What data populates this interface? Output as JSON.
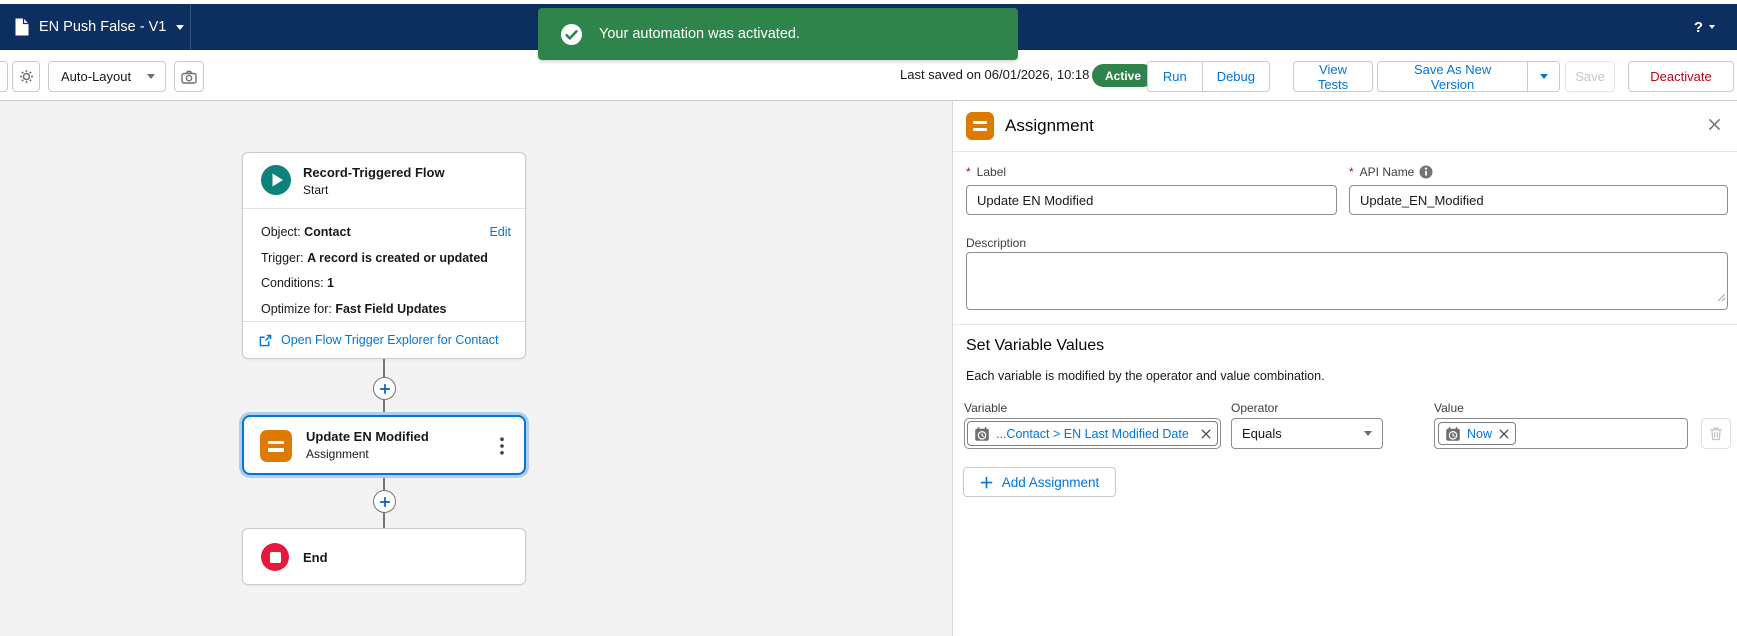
{
  "header": {
    "title": "EN Push False - V1",
    "help_label": "?"
  },
  "toast": {
    "message": "Your automation was activated."
  },
  "toolbar": {
    "auto_layout_label": "Auto-Layout",
    "last_saved": "Last saved on 06/01/2026, 10:18",
    "status_badge": "Active",
    "run_label": "Run",
    "debug_label": "Debug",
    "view_tests_label": "View Tests",
    "save_as_new_label": "Save As New Version",
    "save_label": "Save",
    "deactivate_label": "Deactivate"
  },
  "canvas": {
    "start": {
      "title": "Record-Triggered Flow",
      "subtitle": "Start",
      "edit_label": "Edit",
      "rows": [
        {
          "label": "Object:",
          "value": "Contact"
        },
        {
          "label": "Trigger:",
          "value": "A record is created or updated"
        },
        {
          "label": "Conditions:",
          "value": "1"
        },
        {
          "label": "Optimize for:",
          "value": "Fast Field Updates"
        }
      ],
      "footer_link": "Open Flow Trigger Explorer for Contact"
    },
    "assignment": {
      "title": "Update EN Modified",
      "subtitle": "Assignment"
    },
    "end": {
      "title": "End"
    }
  },
  "panel": {
    "title": "Assignment",
    "required_marker": "*",
    "label_field": {
      "label": "Label",
      "value": "Update EN Modified"
    },
    "api_field": {
      "label": "API Name",
      "value": "Update_EN_Modified"
    },
    "description_label": "Description",
    "section": {
      "title": "Set Variable Values",
      "help": "Each variable is modified by the operator and value combination.",
      "col_variable": "Variable",
      "col_operator": "Operator",
      "col_value": "Value",
      "variable_pill": "...Contact > EN Last Modified Date",
      "operator_value": "Equals",
      "value_pill": "Now",
      "add_label": "Add Assignment"
    }
  },
  "colors": {
    "header_bg": "#0d2f5f",
    "success_green": "#2e844a",
    "brand_blue": "#0176d3",
    "destructive_red": "#ba0517",
    "assignment_orange": "#dd7a01",
    "start_teal": "#0b827c",
    "end_red": "#e6193c",
    "canvas_bg": "#f4f3f3"
  }
}
